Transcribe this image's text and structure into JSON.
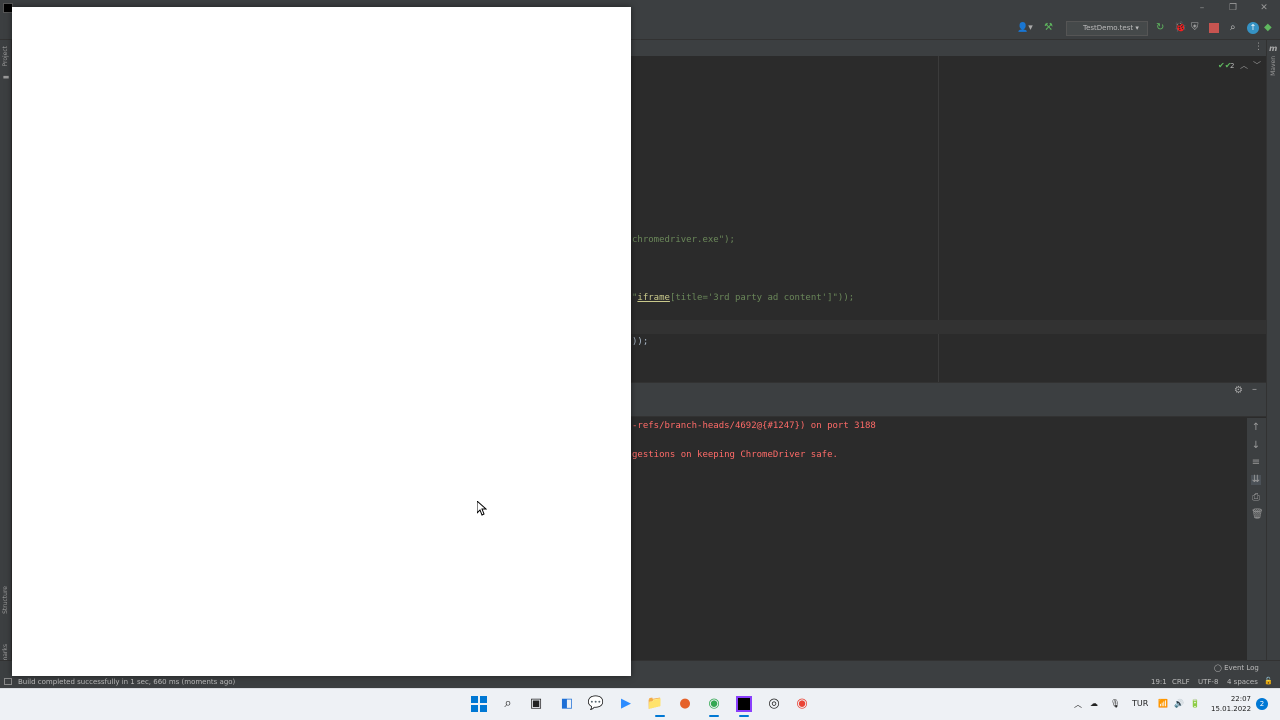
{
  "toolbar": {
    "run_config": "TestDemo.test",
    "inspection_count": "2"
  },
  "left_panel": {
    "project_label": "Project",
    "structure_label": "Structure",
    "bookmarks_label": "Bookmarks"
  },
  "right_panel": {
    "maven_label": "Maven"
  },
  "editor": {
    "line1": "chromedriver.exe\");",
    "line2_tag": "iframe",
    "line2_rest": "[title='3rd party ad content']\"));",
    "line2_quote": "\"",
    "line3": "));"
  },
  "console": {
    "line1": "-refs/branch-heads/4692@{#1247}) on port 3188",
    "line2": "gestions on keeping ChromeDriver safe."
  },
  "bottom_bar": {
    "event_log": "Event Log"
  },
  "status": {
    "message": "Build completed successfully in 1 sec, 660 ms (moments ago)",
    "position": "19:1",
    "line_sep": "CRLF",
    "encoding": "UTF-8",
    "indent": "4 spaces"
  },
  "taskbar": {
    "language": "TUR",
    "time": "22:07",
    "date": "15.01.2022",
    "notification_count": "2"
  },
  "icons": {
    "start": "windows-start-icon",
    "search": "search-icon",
    "task_view": "task-view-icon",
    "widgets": "widgets-icon",
    "chat": "teams-chat-icon",
    "zoom": "zoom-icon",
    "explorer": "file-explorer-icon",
    "firefox": "firefox-icon",
    "chrome": "chrome-icon",
    "intellij": "intellij-icon",
    "obs": "obs-icon",
    "chrome2": "chrome-icon"
  },
  "colors": {
    "ide_bg": "#2b2b2b",
    "error_text": "#ff6b68",
    "string_green": "#6a8759",
    "taskbar_bg": "#eef1f5"
  }
}
